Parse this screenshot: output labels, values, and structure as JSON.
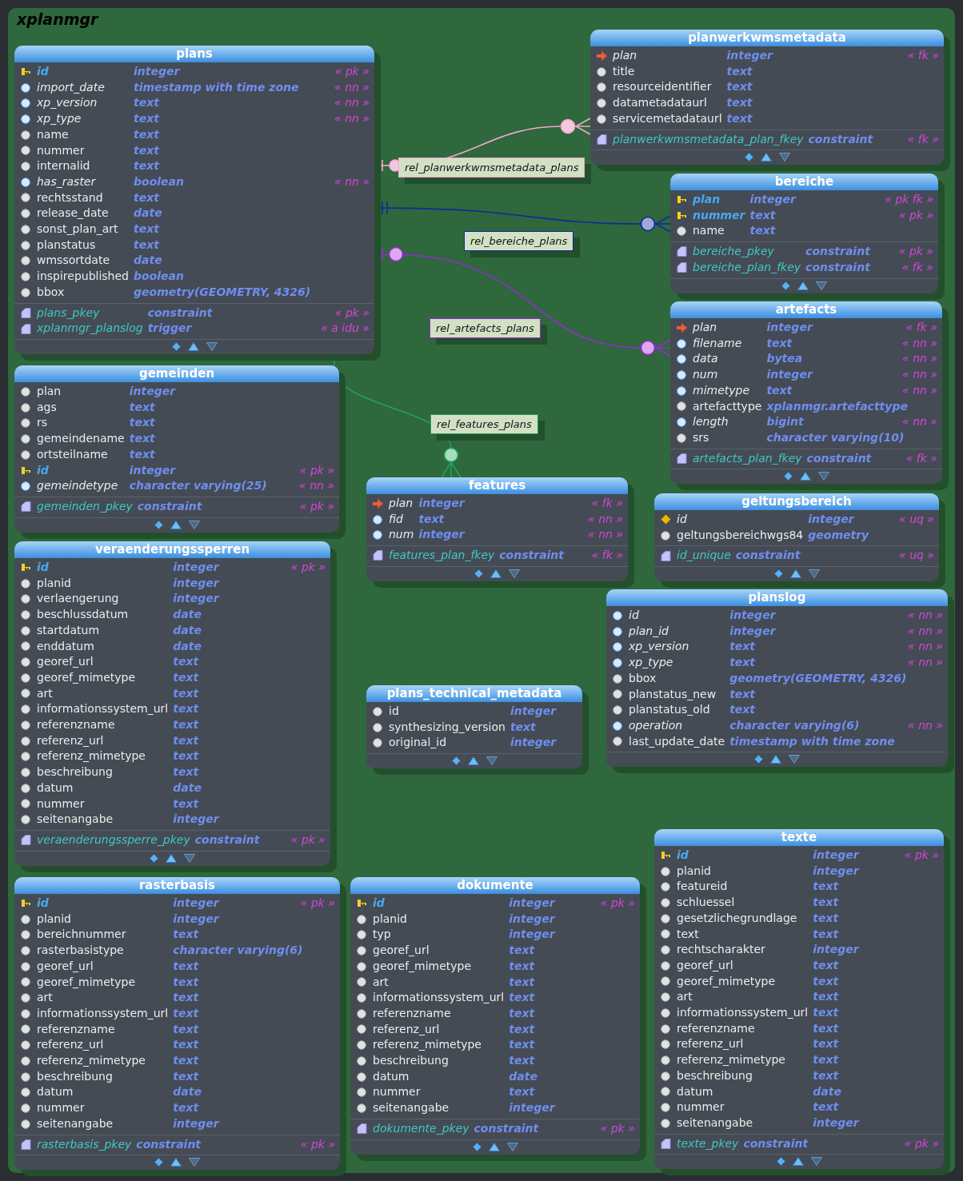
{
  "schema": {
    "title": "xplanmgr"
  },
  "tables": [
    {
      "name": "plans",
      "columns": [
        {
          "name": "id",
          "type": "integer",
          "flag": "« pk »",
          "kind": "pk"
        },
        {
          "name": "import_date",
          "type": "timestamp with time zone",
          "flag": "« nn »",
          "kind": "nn"
        },
        {
          "name": "xp_version",
          "type": "text",
          "flag": "« nn »",
          "kind": "nn"
        },
        {
          "name": "xp_type",
          "type": "text",
          "flag": "« nn »",
          "kind": "nn"
        },
        {
          "name": "name",
          "type": "text",
          "kind": "plain"
        },
        {
          "name": "nummer",
          "type": "text",
          "kind": "plain"
        },
        {
          "name": "internalid",
          "type": "text",
          "kind": "plain"
        },
        {
          "name": "has_raster",
          "type": "boolean",
          "flag": "« nn »",
          "kind": "nn"
        },
        {
          "name": "rechtsstand",
          "type": "text",
          "kind": "plain"
        },
        {
          "name": "release_date",
          "type": "date",
          "kind": "plain"
        },
        {
          "name": "sonst_plan_art",
          "type": "text",
          "kind": "plain"
        },
        {
          "name": "planstatus",
          "type": "text",
          "kind": "plain"
        },
        {
          "name": "wmssortdate",
          "type": "date",
          "kind": "plain"
        },
        {
          "name": "inspirepublished",
          "type": "boolean",
          "kind": "plain"
        },
        {
          "name": "bbox",
          "type": "geometry(GEOMETRY, 4326)",
          "kind": "plain"
        }
      ],
      "constraints": [
        {
          "name": "plans_pkey",
          "type": "constraint",
          "flag": "« pk »"
        },
        {
          "name": "xplanmgr_planslog",
          "type": "trigger",
          "flag": "« a idu »"
        }
      ]
    },
    {
      "name": "planwerkwmsmetadata",
      "columns": [
        {
          "name": "plan",
          "type": "integer",
          "flag": "« fk »",
          "kind": "fk"
        },
        {
          "name": "title",
          "type": "text",
          "kind": "plain"
        },
        {
          "name": "resourceidentifier",
          "type": "text",
          "kind": "plain"
        },
        {
          "name": "datametadataurl",
          "type": "text",
          "kind": "plain"
        },
        {
          "name": "servicemetadataurl",
          "type": "text",
          "kind": "plain"
        }
      ],
      "constraints": [
        {
          "name": "planwerkwmsmetadata_plan_fkey",
          "type": "constraint",
          "flag": "« fk »"
        }
      ]
    },
    {
      "name": "bereiche",
      "columns": [
        {
          "name": "plan",
          "type": "integer",
          "flag": "« pk fk »",
          "kind": "pk"
        },
        {
          "name": "nummer",
          "type": "text",
          "flag": "« pk »",
          "kind": "pk"
        },
        {
          "name": "name",
          "type": "text",
          "kind": "plain"
        }
      ],
      "constraints": [
        {
          "name": "bereiche_pkey",
          "type": "constraint",
          "flag": "« pk »"
        },
        {
          "name": "bereiche_plan_fkey",
          "type": "constraint",
          "flag": "« fk »"
        }
      ]
    },
    {
      "name": "artefacts",
      "columns": [
        {
          "name": "plan",
          "type": "integer",
          "flag": "« fk »",
          "kind": "fk"
        },
        {
          "name": "filename",
          "type": "text",
          "flag": "« nn »",
          "kind": "nn"
        },
        {
          "name": "data",
          "type": "bytea",
          "flag": "« nn »",
          "kind": "nn"
        },
        {
          "name": "num",
          "type": "integer",
          "flag": "« nn »",
          "kind": "nn"
        },
        {
          "name": "mimetype",
          "type": "text",
          "flag": "« nn »",
          "kind": "nn"
        },
        {
          "name": "artefacttype",
          "type": "xplanmgr.artefacttype",
          "kind": "plain"
        },
        {
          "name": "length",
          "type": "bigint",
          "flag": "« nn »",
          "kind": "nn"
        },
        {
          "name": "srs",
          "type": "character varying(10)",
          "kind": "plain"
        }
      ],
      "constraints": [
        {
          "name": "artefacts_plan_fkey",
          "type": "constraint",
          "flag": "« fk »"
        }
      ]
    },
    {
      "name": "gemeinden",
      "columns": [
        {
          "name": "plan",
          "type": "integer",
          "kind": "plain"
        },
        {
          "name": "ags",
          "type": "text",
          "kind": "plain"
        },
        {
          "name": "rs",
          "type": "text",
          "kind": "plain"
        },
        {
          "name": "gemeindename",
          "type": "text",
          "kind": "plain"
        },
        {
          "name": "ortsteilname",
          "type": "text",
          "kind": "plain"
        },
        {
          "name": "id",
          "type": "integer",
          "flag": "« pk »",
          "kind": "pk"
        },
        {
          "name": "gemeindetype",
          "type": "character varying(25)",
          "flag": "« nn »",
          "kind": "nn"
        }
      ],
      "constraints": [
        {
          "name": "gemeinden_pkey",
          "type": "constraint",
          "flag": "« pk »"
        }
      ]
    },
    {
      "name": "features",
      "columns": [
        {
          "name": "plan",
          "type": "integer",
          "flag": "« fk »",
          "kind": "fk"
        },
        {
          "name": "fid",
          "type": "text",
          "flag": "« nn »",
          "kind": "nn"
        },
        {
          "name": "num",
          "type": "integer",
          "flag": "« nn »",
          "kind": "nn"
        }
      ],
      "constraints": [
        {
          "name": "features_plan_fkey",
          "type": "constraint",
          "flag": "« fk »"
        }
      ]
    },
    {
      "name": "geltungsbereich",
      "columns": [
        {
          "name": "id",
          "type": "integer",
          "flag": "« uq »",
          "kind": "uq"
        },
        {
          "name": "geltungsbereichwgs84",
          "type": "geometry",
          "kind": "plain"
        }
      ],
      "constraints": [
        {
          "name": "id_unique",
          "type": "constraint",
          "flag": "« uq »"
        }
      ]
    },
    {
      "name": "veraenderungssperren",
      "columns": [
        {
          "name": "id",
          "type": "integer",
          "flag": "« pk »",
          "kind": "pk"
        },
        {
          "name": "planid",
          "type": "integer",
          "kind": "plain"
        },
        {
          "name": "verlaengerung",
          "type": "integer",
          "kind": "plain"
        },
        {
          "name": "beschlussdatum",
          "type": "date",
          "kind": "plain"
        },
        {
          "name": "startdatum",
          "type": "date",
          "kind": "plain"
        },
        {
          "name": "enddatum",
          "type": "date",
          "kind": "plain"
        },
        {
          "name": "georef_url",
          "type": "text",
          "kind": "plain"
        },
        {
          "name": "georef_mimetype",
          "type": "text",
          "kind": "plain"
        },
        {
          "name": "art",
          "type": "text",
          "kind": "plain"
        },
        {
          "name": "informationssystem_url",
          "type": "text",
          "kind": "plain"
        },
        {
          "name": "referenzname",
          "type": "text",
          "kind": "plain"
        },
        {
          "name": "referenz_url",
          "type": "text",
          "kind": "plain"
        },
        {
          "name": "referenz_mimetype",
          "type": "text",
          "kind": "plain"
        },
        {
          "name": "beschreibung",
          "type": "text",
          "kind": "plain"
        },
        {
          "name": "datum",
          "type": "date",
          "kind": "plain"
        },
        {
          "name": "nummer",
          "type": "text",
          "kind": "plain"
        },
        {
          "name": "seitenangabe",
          "type": "integer",
          "kind": "plain"
        }
      ],
      "constraints": [
        {
          "name": "veraenderungssperre_pkey",
          "type": "constraint",
          "flag": "« pk »"
        }
      ]
    },
    {
      "name": "plans_technical_metadata",
      "columns": [
        {
          "name": "id",
          "type": "integer",
          "kind": "plain"
        },
        {
          "name": "synthesizing_version",
          "type": "text",
          "kind": "plain"
        },
        {
          "name": "original_id",
          "type": "integer",
          "kind": "plain"
        }
      ]
    },
    {
      "name": "planslog",
      "columns": [
        {
          "name": "id",
          "type": "integer",
          "flag": "« nn »",
          "kind": "nn"
        },
        {
          "name": "plan_id",
          "type": "integer",
          "flag": "« nn »",
          "kind": "nn"
        },
        {
          "name": "xp_version",
          "type": "text",
          "flag": "« nn »",
          "kind": "nn"
        },
        {
          "name": "xp_type",
          "type": "text",
          "flag": "« nn »",
          "kind": "nn"
        },
        {
          "name": "bbox",
          "type": "geometry(GEOMETRY, 4326)",
          "kind": "plain"
        },
        {
          "name": "planstatus_new",
          "type": "text",
          "kind": "plain"
        },
        {
          "name": "planstatus_old",
          "type": "text",
          "kind": "plain"
        },
        {
          "name": "operation",
          "type": "character varying(6)",
          "flag": "« nn »",
          "kind": "nn"
        },
        {
          "name": "last_update_date",
          "type": "timestamp with time zone",
          "kind": "plain"
        }
      ]
    },
    {
      "name": "rasterbasis",
      "columns": [
        {
          "name": "id",
          "type": "integer",
          "flag": "« pk »",
          "kind": "pk"
        },
        {
          "name": "planid",
          "type": "integer",
          "kind": "plain"
        },
        {
          "name": "bereichnummer",
          "type": "text",
          "kind": "plain"
        },
        {
          "name": "rasterbasistype",
          "type": "character varying(6)",
          "kind": "plain"
        },
        {
          "name": "georef_url",
          "type": "text",
          "kind": "plain"
        },
        {
          "name": "georef_mimetype",
          "type": "text",
          "kind": "plain"
        },
        {
          "name": "art",
          "type": "text",
          "kind": "plain"
        },
        {
          "name": "informationssystem_url",
          "type": "text",
          "kind": "plain"
        },
        {
          "name": "referenzname",
          "type": "text",
          "kind": "plain"
        },
        {
          "name": "referenz_url",
          "type": "text",
          "kind": "plain"
        },
        {
          "name": "referenz_mimetype",
          "type": "text",
          "kind": "plain"
        },
        {
          "name": "beschreibung",
          "type": "text",
          "kind": "plain"
        },
        {
          "name": "datum",
          "type": "date",
          "kind": "plain"
        },
        {
          "name": "nummer",
          "type": "text",
          "kind": "plain"
        },
        {
          "name": "seitenangabe",
          "type": "integer",
          "kind": "plain"
        }
      ],
      "constraints": [
        {
          "name": "rasterbasis_pkey",
          "type": "constraint",
          "flag": "« pk »"
        }
      ]
    },
    {
      "name": "dokumente",
      "columns": [
        {
          "name": "id",
          "type": "integer",
          "flag": "« pk »",
          "kind": "pk"
        },
        {
          "name": "planid",
          "type": "integer",
          "kind": "plain"
        },
        {
          "name": "typ",
          "type": "integer",
          "kind": "plain"
        },
        {
          "name": "georef_url",
          "type": "text",
          "kind": "plain"
        },
        {
          "name": "georef_mimetype",
          "type": "text",
          "kind": "plain"
        },
        {
          "name": "art",
          "type": "text",
          "kind": "plain"
        },
        {
          "name": "informationssystem_url",
          "type": "text",
          "kind": "plain"
        },
        {
          "name": "referenzname",
          "type": "text",
          "kind": "plain"
        },
        {
          "name": "referenz_url",
          "type": "text",
          "kind": "plain"
        },
        {
          "name": "referenz_mimetype",
          "type": "text",
          "kind": "plain"
        },
        {
          "name": "beschreibung",
          "type": "text",
          "kind": "plain"
        },
        {
          "name": "datum",
          "type": "date",
          "kind": "plain"
        },
        {
          "name": "nummer",
          "type": "text",
          "kind": "plain"
        },
        {
          "name": "seitenangabe",
          "type": "integer",
          "kind": "plain"
        }
      ],
      "constraints": [
        {
          "name": "dokumente_pkey",
          "type": "constraint",
          "flag": "« pk »"
        }
      ]
    },
    {
      "name": "texte",
      "columns": [
        {
          "name": "id",
          "type": "integer",
          "flag": "« pk »",
          "kind": "pk"
        },
        {
          "name": "planid",
          "type": "integer",
          "kind": "plain"
        },
        {
          "name": "featureid",
          "type": "text",
          "kind": "plain"
        },
        {
          "name": "schluessel",
          "type": "text",
          "kind": "plain"
        },
        {
          "name": "gesetzlichegrundlage",
          "type": "text",
          "kind": "plain"
        },
        {
          "name": "text",
          "type": "text",
          "kind": "plain"
        },
        {
          "name": "rechtscharakter",
          "type": "integer",
          "kind": "plain"
        },
        {
          "name": "georef_url",
          "type": "text",
          "kind": "plain"
        },
        {
          "name": "georef_mimetype",
          "type": "text",
          "kind": "plain"
        },
        {
          "name": "art",
          "type": "text",
          "kind": "plain"
        },
        {
          "name": "informationssystem_url",
          "type": "text",
          "kind": "plain"
        },
        {
          "name": "referenzname",
          "type": "text",
          "kind": "plain"
        },
        {
          "name": "referenz_url",
          "type": "text",
          "kind": "plain"
        },
        {
          "name": "referenz_mimetype",
          "type": "text",
          "kind": "plain"
        },
        {
          "name": "beschreibung",
          "type": "text",
          "kind": "plain"
        },
        {
          "name": "datum",
          "type": "date",
          "kind": "plain"
        },
        {
          "name": "nummer",
          "type": "text",
          "kind": "plain"
        },
        {
          "name": "seitenangabe",
          "type": "integer",
          "kind": "plain"
        }
      ],
      "constraints": [
        {
          "name": "texte_pkey",
          "type": "constraint",
          "flag": "« pk »"
        }
      ]
    }
  ],
  "relations": [
    {
      "label": "rel_planwerkwmsmetadata_plans",
      "color": "#f0a8d0"
    },
    {
      "label": "rel_bereiche_plans",
      "color": "#102a9a"
    },
    {
      "label": "rel_artefacts_plans",
      "color": "#9a28d8"
    },
    {
      "label": "rel_features_plans",
      "color": "#20a060"
    }
  ]
}
